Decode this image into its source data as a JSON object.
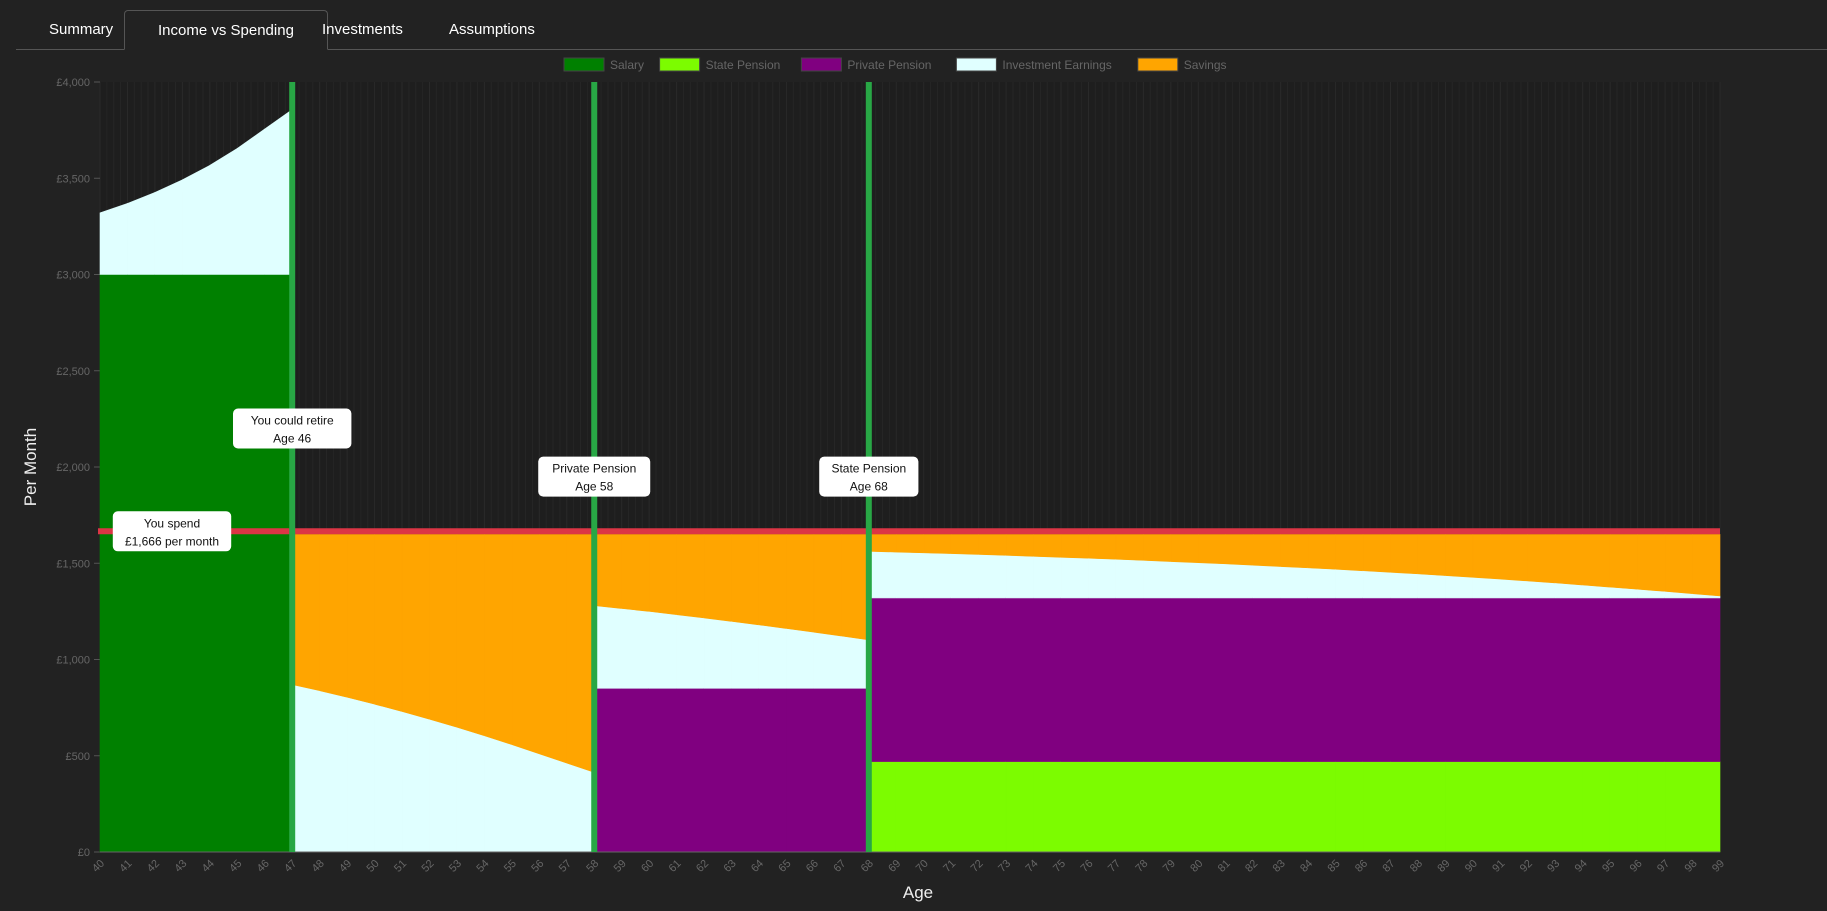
{
  "tabs": [
    {
      "label": "Summary",
      "active": false
    },
    {
      "label": "Income vs Spending",
      "active": true
    },
    {
      "label": "Investments",
      "active": false
    },
    {
      "label": "Assumptions",
      "active": false
    }
  ],
  "chart_data": {
    "type": "area",
    "stacked": true,
    "xlabel": "Age",
    "ylabel": "Per Month",
    "ylim": [
      0,
      4000
    ],
    "yticks": [
      "£0",
      "£500",
      "£1,000",
      "£1,500",
      "£2,000",
      "£2,500",
      "£3,000",
      "£3,500",
      "£4,000"
    ],
    "ytick_values": [
      0,
      500,
      1000,
      1500,
      2000,
      2500,
      3000,
      3500,
      4000
    ],
    "x": [
      40,
      41,
      42,
      43,
      44,
      45,
      46,
      47,
      48,
      49,
      50,
      51,
      52,
      53,
      54,
      55,
      56,
      57,
      58,
      59,
      60,
      61,
      62,
      63,
      64,
      65,
      66,
      67,
      68,
      69,
      70,
      71,
      72,
      73,
      74,
      75,
      76,
      77,
      78,
      79,
      80,
      81,
      82,
      83,
      84,
      85,
      86,
      87,
      88,
      89,
      90,
      91,
      92,
      93,
      94,
      95,
      96,
      97,
      98,
      99
    ],
    "legend_position": "top",
    "grid": true,
    "series": [
      {
        "name": "Salary",
        "color": "#008000",
        "values": [
          3000,
          3000,
          3000,
          3000,
          3000,
          3000,
          3000,
          0,
          0,
          0,
          0,
          0,
          0,
          0,
          0,
          0,
          0,
          0,
          0,
          0,
          0,
          0,
          0,
          0,
          0,
          0,
          0,
          0,
          0,
          0,
          0,
          0,
          0,
          0,
          0,
          0,
          0,
          0,
          0,
          0,
          0,
          0,
          0,
          0,
          0,
          0,
          0,
          0,
          0,
          0,
          0,
          0,
          0,
          0,
          0,
          0,
          0,
          0,
          0,
          0
        ]
      },
      {
        "name": "State Pension",
        "color": "#7cfc00",
        "values": [
          0,
          0,
          0,
          0,
          0,
          0,
          0,
          0,
          0,
          0,
          0,
          0,
          0,
          0,
          0,
          0,
          0,
          0,
          0,
          0,
          0,
          0,
          0,
          0,
          0,
          0,
          0,
          0,
          470,
          470,
          470,
          470,
          470,
          470,
          470,
          470,
          470,
          470,
          470,
          470,
          470,
          470,
          470,
          470,
          470,
          470,
          470,
          470,
          470,
          470,
          470,
          470,
          470,
          470,
          470,
          470,
          470,
          470,
          470,
          470
        ]
      },
      {
        "name": "Private Pension",
        "color": "#800080",
        "values": [
          0,
          0,
          0,
          0,
          0,
          0,
          0,
          0,
          0,
          0,
          0,
          0,
          0,
          0,
          0,
          0,
          0,
          0,
          850,
          850,
          850,
          850,
          850,
          850,
          850,
          850,
          850,
          850,
          850,
          850,
          850,
          850,
          850,
          850,
          850,
          850,
          850,
          850,
          850,
          850,
          850,
          850,
          850,
          850,
          850,
          850,
          850,
          850,
          850,
          850,
          850,
          850,
          850,
          850,
          850,
          850,
          850,
          850,
          850,
          850
        ]
      },
      {
        "name": "Investment Earnings",
        "color": "#e0ffff",
        "values": [
          320,
          369,
          426,
          492,
          567,
          655,
          756,
          870,
          838,
          804,
          768,
          730,
          690,
          648,
          604,
          558,
          510,
          462,
          430,
          415,
          400,
          383,
          366,
          348,
          330,
          311,
          292,
          272,
          242,
          238,
          234,
          230,
          226,
          221,
          216,
          211,
          206,
          201,
          195,
          189,
          183,
          177,
          170,
          163,
          156,
          149,
          141,
          133,
          125,
          116,
          107,
          98,
          88,
          78,
          67,
          56,
          45,
          34,
          22,
          10
        ]
      },
      {
        "name": "Savings",
        "color": "#ffa500",
        "values": [
          0,
          0,
          0,
          0,
          0,
          0,
          0,
          780,
          812,
          846,
          882,
          920,
          960,
          1002,
          1046,
          1092,
          1140,
          1188,
          370,
          385,
          400,
          417,
          434,
          452,
          470,
          489,
          508,
          528,
          88,
          92,
          96,
          100,
          104,
          109,
          114,
          119,
          124,
          129,
          135,
          141,
          147,
          153,
          160,
          167,
          174,
          181,
          189,
          197,
          205,
          214,
          223,
          232,
          242,
          252,
          263,
          274,
          285,
          296,
          308,
          320
        ]
      }
    ],
    "spending": {
      "value": 1666,
      "color": "#dc3545",
      "label_line1": "You spend",
      "label_line2": "£1,666 per month"
    },
    "markers": [
      {
        "age": 47,
        "color": "#28a745",
        "label_line1": "You could retire",
        "label_line2": "Age 46",
        "label_value": 2200
      },
      {
        "age": 58,
        "color": "#28a745",
        "label_line1": "Private Pension",
        "label_line2": "Age 58",
        "label_value": 1950
      },
      {
        "age": 68,
        "color": "#28a745",
        "label_line1": "State Pension",
        "label_line2": "Age 68",
        "label_value": 1950
      }
    ]
  }
}
